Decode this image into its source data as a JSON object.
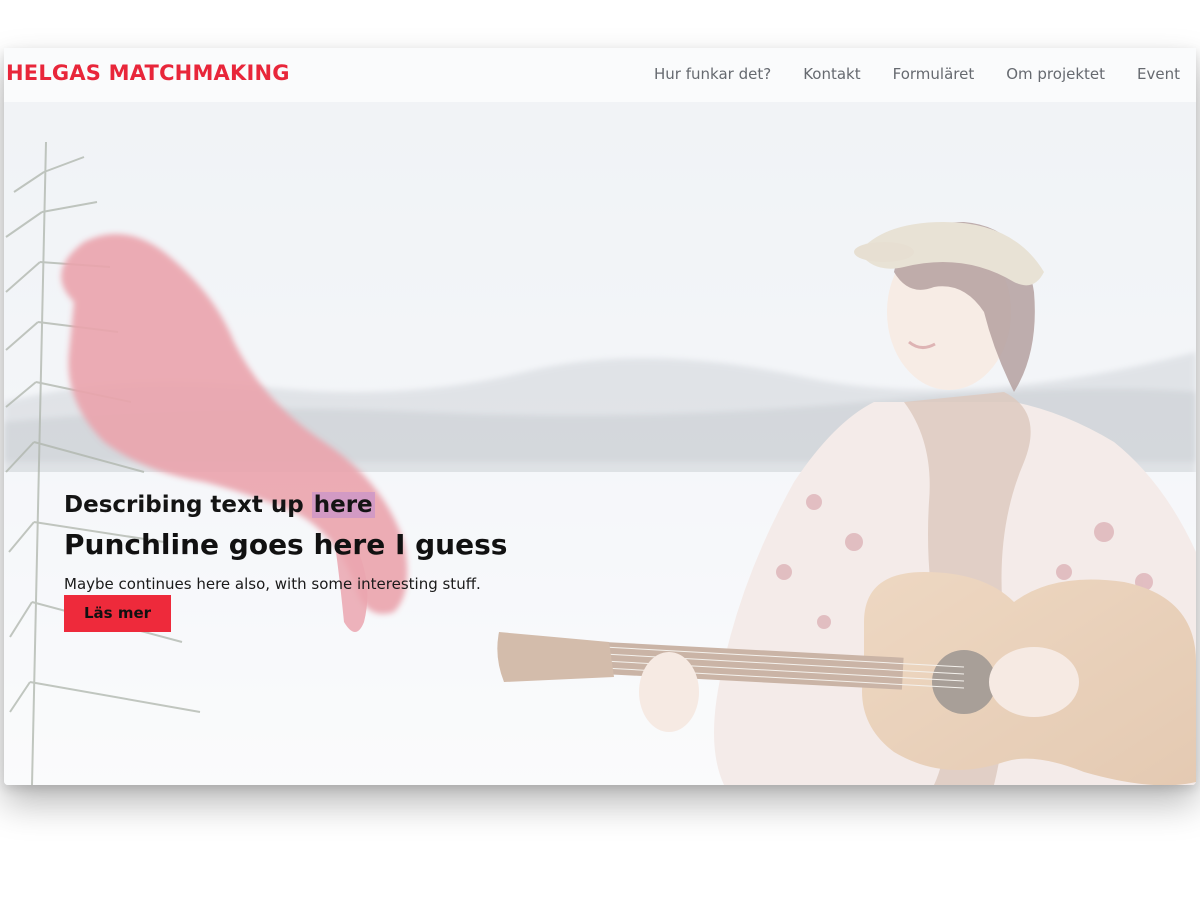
{
  "header": {
    "logo": "HELGAS MATCHMAKING",
    "nav": [
      {
        "label": "Hur funkar det?"
      },
      {
        "label": "Kontakt"
      },
      {
        "label": "Formuläret"
      },
      {
        "label": "Om projektet"
      },
      {
        "label": "Event"
      }
    ]
  },
  "hero": {
    "eyebrow_start": "Describing text up ",
    "eyebrow_highlight": "here",
    "punchline": "Punchline goes here I guess",
    "subtext": "Maybe continues here also, with some interesting stuff.",
    "cta_label": "Läs mer"
  },
  "colors": {
    "brand": "#e8263a",
    "cta_bg": "#ee2a3b",
    "nav_text": "#666a70"
  }
}
